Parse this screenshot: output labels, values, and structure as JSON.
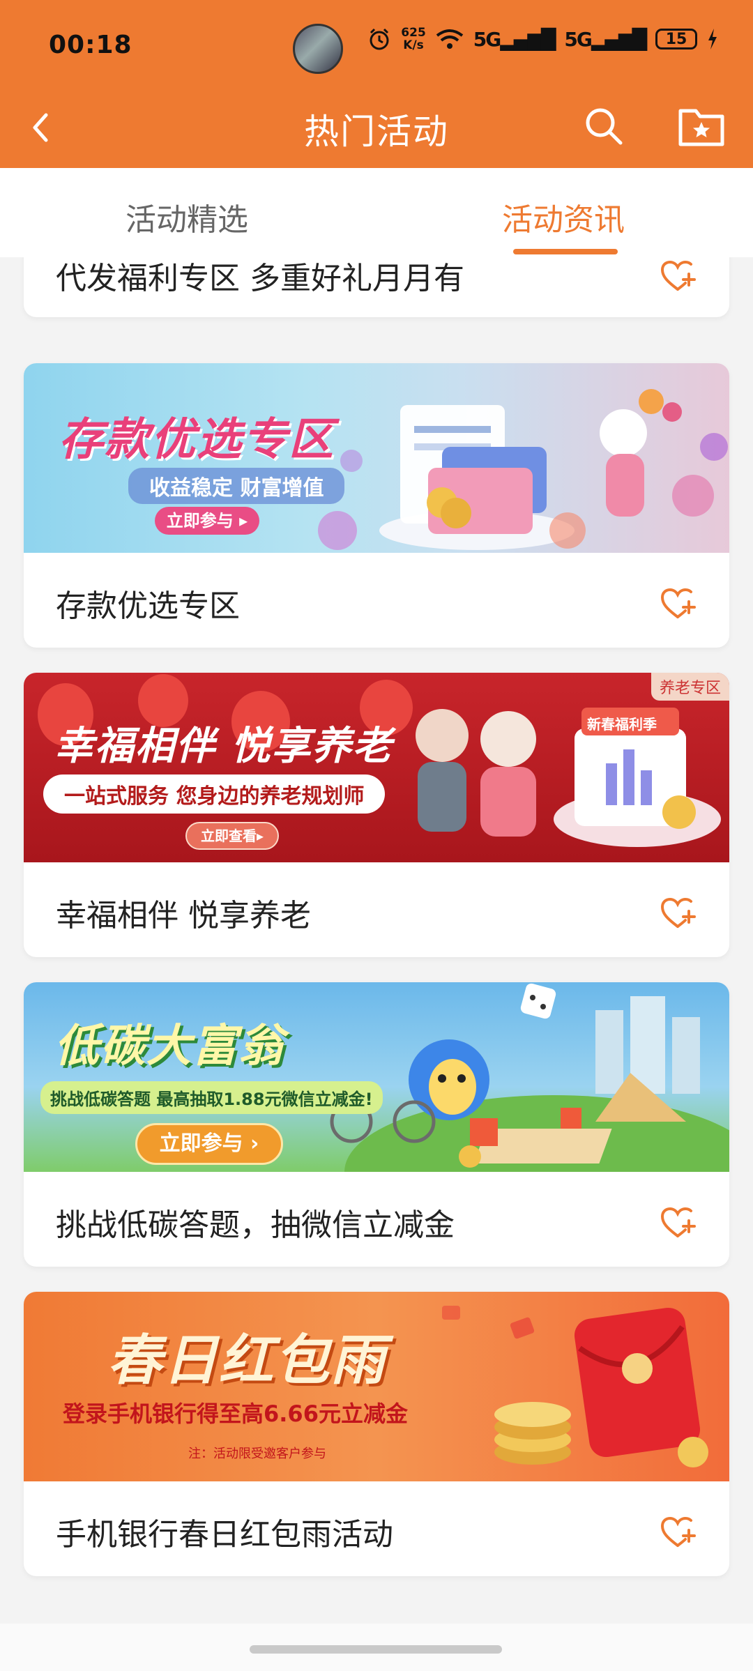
{
  "status_bar": {
    "time": "00:18",
    "net_speed_value": "625",
    "net_speed_unit": "K/s",
    "signal1": "5G",
    "signal2": "5G",
    "battery": "15"
  },
  "header": {
    "title": "热门活动",
    "back_icon": "chevron-left-icon",
    "search_icon": "search-icon",
    "favorites_icon": "folder-star-icon"
  },
  "tabs": [
    {
      "label": "活动精选",
      "selected": false
    },
    {
      "label": "活动资讯",
      "selected": true
    }
  ],
  "colors": {
    "accent": "#ee7a31",
    "background": "#f3f3f3"
  },
  "cards": [
    {
      "title": "代发福利专区 多重好礼月月有"
    },
    {
      "title": "存款优选专区",
      "banner": {
        "headline": "存款优选专区",
        "subline": "收益稳定 财富增值",
        "button": "立即参与 ▸"
      }
    },
    {
      "title": "幸福相伴 悦享养老",
      "banner": {
        "headline": "幸福相伴 悦享养老",
        "subline": "一站式服务 您身边的养老规划师",
        "button": "立即查看▸",
        "corner_tag": "养老专区",
        "calendar_tag": "新春福利季"
      }
    },
    {
      "title": "挑战低碳答题，抽微信立减金",
      "banner": {
        "headline": "低碳大富翁",
        "subline": "挑战低碳答题 最高抽取1.88元微信立减金!",
        "button": "立即参与 ›"
      }
    },
    {
      "title": "手机银行春日红包雨活动",
      "banner": {
        "headline": "春日红包雨",
        "subline": "登录手机银行得至高6.66元立减金",
        "note": "注：活动限受邀客户参与"
      }
    }
  ]
}
